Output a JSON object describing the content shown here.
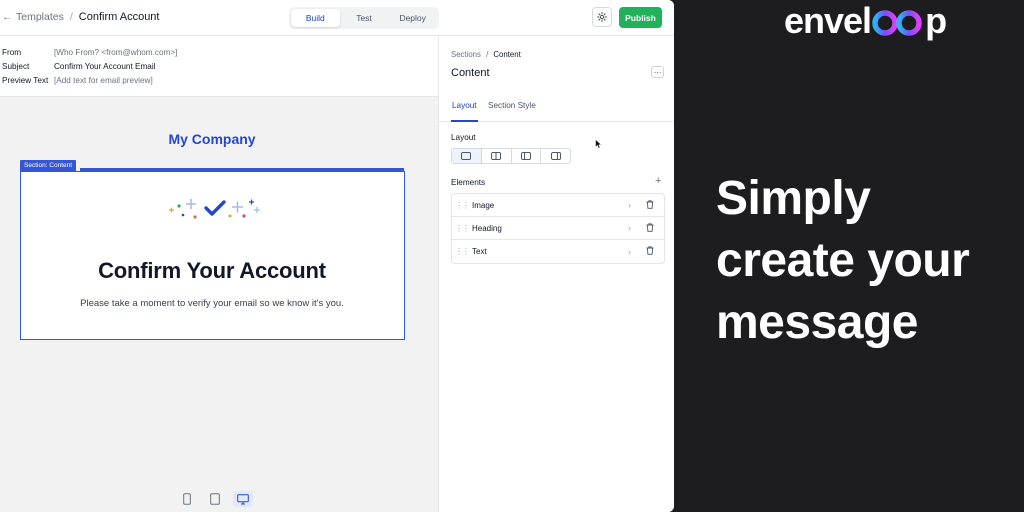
{
  "header": {
    "back_label": "Templates",
    "separator": "/",
    "current": "Confirm Account",
    "modes": [
      "Build",
      "Test",
      "Deploy"
    ],
    "active_mode": "Build",
    "publish_label": "Publish"
  },
  "meta": {
    "rows": [
      {
        "key": "From",
        "value": "[Who From? <from@whom.com>]",
        "placeholder": true
      },
      {
        "key": "Subject",
        "value": "Confirm Your Account Email",
        "placeholder": false
      },
      {
        "key": "Preview Text",
        "value": "[Add text for email preview]",
        "placeholder": true
      }
    ]
  },
  "canvas": {
    "company": "My Company",
    "section_tag": "Section: Content",
    "heading": "Confirm Your Account",
    "body": "Please take a moment to verify your email so we know it's you."
  },
  "panel": {
    "crumb_root": "Sections",
    "crumb_sep": "/",
    "crumb_current": "Content",
    "title": "Content",
    "more_label": "…",
    "tabs": [
      "Layout",
      "Section Style"
    ],
    "active_tab": "Layout",
    "layout_label": "Layout",
    "elements_label": "Elements",
    "elements": [
      "Image",
      "Heading",
      "Text"
    ]
  },
  "brand": {
    "logo_left": "envel",
    "logo_right": "p"
  },
  "promo": {
    "line1": "Simply",
    "line2": "create your",
    "line3": "message"
  },
  "colors": {
    "accent": "#2747c6",
    "publish": "#1fb25a",
    "promo_bg": "#1d1d1f"
  }
}
